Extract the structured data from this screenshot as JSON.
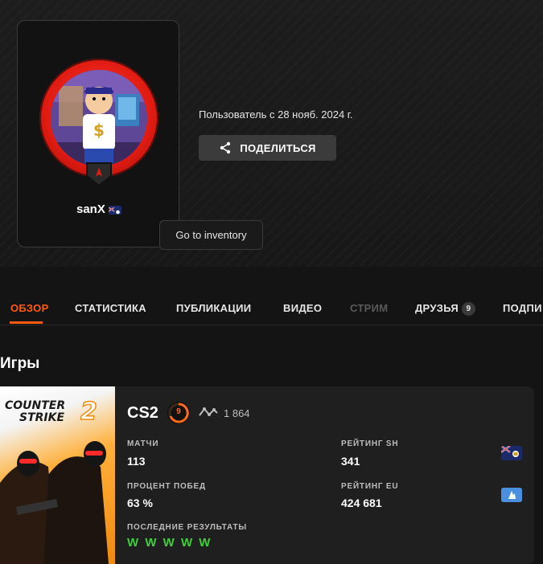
{
  "profile": {
    "username": "sanX",
    "member_since": "Пользователь с 28 нояб. 2024 г.",
    "share_label": "ПОДЕЛИТЬСЯ",
    "tooltip": "Go to inventory"
  },
  "tabs": [
    {
      "label": "ОБЗОР",
      "state": "active"
    },
    {
      "label": "СТАТИСТИКА",
      "state": "normal"
    },
    {
      "label": "ПУБЛИКАЦИИ",
      "state": "normal"
    },
    {
      "label": "ВИДЕО",
      "state": "normal"
    },
    {
      "label": "СТРИМ",
      "state": "disabled"
    },
    {
      "label": "ДРУЗЬЯ",
      "state": "normal",
      "count": "9"
    },
    {
      "label": "ПОДПИ",
      "state": "normal"
    }
  ],
  "games_section": {
    "title": "Игры"
  },
  "game": {
    "cover_title_line1": "COUNTER",
    "cover_title_line2": "STRIKE",
    "cover_title_num": "2",
    "name": "CS2",
    "level": "9",
    "elo": "1 864",
    "stats": {
      "matches_label": "МАТЧИ",
      "matches_value": "113",
      "winrate_label": "ПРОЦЕНТ ПОБЕД",
      "winrate_value": "63 %",
      "recent_label": "ПОСЛЕДНИЕ РЕЗУЛЬТАТЫ",
      "recent_value": "W W W W W",
      "rating_sh_label": "РЕЙТИНГ SH",
      "rating_sh_value": "341",
      "rating_eu_label": "РЕЙТИНГ EU",
      "rating_eu_value": "424 681"
    }
  },
  "colors": {
    "accent": "#ff5a14",
    "win": "#3ecf3a",
    "ring": "#e01b12"
  },
  "icons": {
    "share": "share-icon",
    "elo": "elo-trend-icon",
    "flag_user": "flag-icon",
    "region_sh": "saint-helena-flag-icon",
    "region_eu": "europe-region-icon"
  }
}
